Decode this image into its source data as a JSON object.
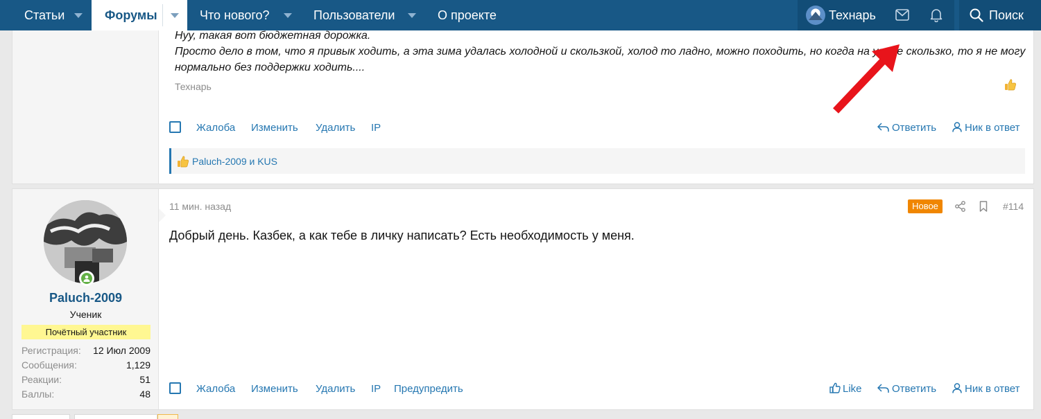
{
  "nav": {
    "articles": "Статьи",
    "forums": "Форумы",
    "whats_new": "Что нового?",
    "users": "Пользователи",
    "about": "О проекте",
    "username": "Технарь",
    "search": "Поиск"
  },
  "post1": {
    "quote_lines": [
      "Нуу, такая вот бюджетная дорожка.",
      "Просто дело в том, что я привык ходить, а эта зима удалась холодной и скользкой, холод то ладно, можно походить, но когда на улице скользко, то я не могу",
      "нормально без поддержки ходить...."
    ],
    "quote_author": "Технарь",
    "actions": {
      "report": "Жалоба",
      "edit": "Изменить",
      "delete": "Удалить",
      "ip": "IP",
      "reply": "Ответить",
      "mention": "Ник в ответ"
    },
    "reactions_text": "Paluch-2009 и KUS"
  },
  "post2": {
    "user": {
      "name": "Paluch-2009",
      "title": "Ученик",
      "banner": "Почётный участник",
      "stats": [
        {
          "label": "Регистрация:",
          "value": "12 Июл 2009"
        },
        {
          "label": "Сообщения:",
          "value": "1,129"
        },
        {
          "label": "Реакции:",
          "value": "51"
        },
        {
          "label": "Баллы:",
          "value": "48"
        }
      ]
    },
    "time": "11 мин. назад",
    "badge": "Новое",
    "post_number": "#114",
    "body": "Добрый день. Казбек, а как тебе в личку написать? Есть необходимость у меня.",
    "actions": {
      "report": "Жалоба",
      "edit": "Изменить",
      "delete": "Удалить",
      "ip": "IP",
      "warn": "Предупредить",
      "like": "Like",
      "reply": "Ответить",
      "mention": "Ник в ответ"
    }
  },
  "colors": {
    "nav_bg": "#185886",
    "link": "#2577b1",
    "badge_new": "#f08600",
    "banner": "#fff792",
    "annotation_arrow": "#e8141b"
  }
}
